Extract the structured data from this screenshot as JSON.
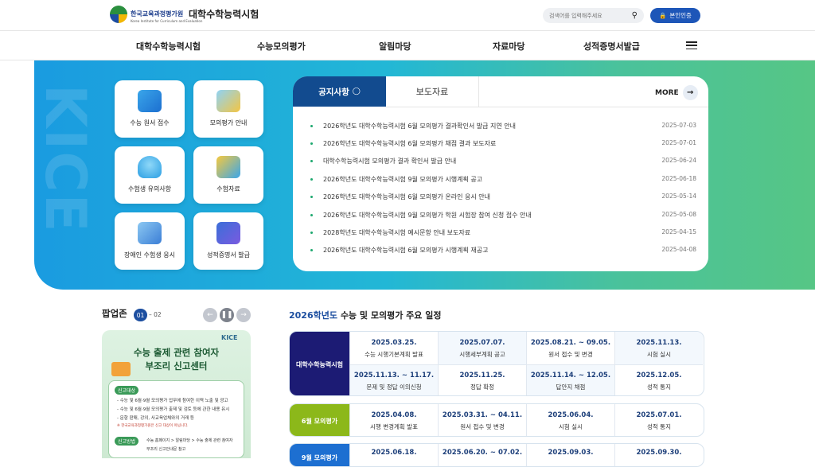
{
  "header": {
    "org_name": "한국교육과정평가원",
    "org_name_en": "Korea Institute for Curriculum and Evaluation",
    "site_title": "대학수학능력시험",
    "search_placeholder": "검색어를 입력해주세요",
    "auth_label": "본인인증"
  },
  "nav": {
    "items": [
      "대학수학능력시험",
      "수능모의평가",
      "알림마당",
      "자료마당",
      "성적증명서발급"
    ]
  },
  "hero": {
    "bg_text": "KICE",
    "tiles": [
      {
        "label": "수능 원서 접수",
        "icon": "laptop-icon"
      },
      {
        "label": "모의평가 안내",
        "icon": "book-icon"
      },
      {
        "label": "수험생 유의사항",
        "icon": "bell-icon"
      },
      {
        "label": "수험자료",
        "icon": "folder-search-icon"
      },
      {
        "label": "장애인 수험생 응시",
        "icon": "people-icon"
      },
      {
        "label": "성적증명서 발급",
        "icon": "monitor-document-icon"
      }
    ]
  },
  "notice": {
    "tab_active": "공지사항",
    "tab_other": "보도자료",
    "more_label": "MORE",
    "items": [
      {
        "title": "2026학년도 대학수학능력시험 6월 모의평가 결과확인서 발급 지연 안내",
        "date": "2025-07-03"
      },
      {
        "title": "2026학년도 대학수학능력시험 6월 모의평가 채점 결과 보도자료",
        "date": "2025-07-01"
      },
      {
        "title": "대학수학능력시험 모의평가 결과 확인서 발급 안내",
        "date": "2025-06-24"
      },
      {
        "title": "2026학년도 대학수학능력시험 9월 모의평가 시행계획 공고",
        "date": "2025-06-18"
      },
      {
        "title": "2026학년도 대학수학능력시험 6월 모의평가 온라인 응시 안내",
        "date": "2025-05-14"
      },
      {
        "title": "2026학년도 대학수학능력시험 9월 모의평가 학원 시험장 참여 신청 접수 안내",
        "date": "2025-05-08"
      },
      {
        "title": "2028학년도 대학수학능력시험 예시문항 안내 보도자료",
        "date": "2025-04-15"
      },
      {
        "title": "2026학년도 대학수학능력시험 6월 모의평가 시행계획 재공고",
        "date": "2025-04-08"
      }
    ]
  },
  "popup": {
    "title": "팝업존",
    "current": "01",
    "separator": "– 02",
    "logo_text": "KICE",
    "headline_1": "수능 출제 관련 참여자",
    "headline_2": "부조리 신고센터",
    "tag_1": "신고대상",
    "lines": [
      "- 수능 및 6월·9월 모의평가 업무에 참여한 이력 노출 및 광고",
      "- 수능 및 6월·9월 모의평가 출제 및 검토 등에 관한 내용 유시",
      "- 문항 판매, 강의, 사교육업체와의 거래 등",
      "※ 한국교육과정평가원은 신고 대상이 아닙니다."
    ],
    "tag_2": "신고방법",
    "method_1": "수능 홈페이지 > 알림마당 > 수능 출제 관련 참여자",
    "method_2": "부조리 신고안내문 참고"
  },
  "schedule": {
    "year": "2026학년도",
    "title_rest": " 수능 및 모의평가 주요 일정",
    "rows": [
      {
        "label": "대학수학능력시험",
        "color": "#1c1b74",
        "cells": [
          {
            "date": "2025.03.25.",
            "event": "수능 시행기본계획 발표"
          },
          {
            "date": "2025.07.07.",
            "event": "시행세부계획 공고"
          },
          {
            "date": "2025.08.21. ~ 09.05.",
            "event": "원서 접수 및 변경"
          },
          {
            "date": "2025.11.13.",
            "event": "시험 실시"
          },
          {
            "date": "2025.11.13. ~ 11.17.",
            "event": "문제 및 정답 이의신청"
          },
          {
            "date": "2025.11.25.",
            "event": "정답 확정"
          },
          {
            "date": "2025.11.14. ~ 12.05.",
            "event": "답안지 채점"
          },
          {
            "date": "2025.12.05.",
            "event": "성적 통지"
          }
        ]
      },
      {
        "label": "6월 모의평가",
        "color": "#8cb81a",
        "cells": [
          {
            "date": "2025.04.08.",
            "event": "시행 변경계획 발표"
          },
          {
            "date": "2025.03.31. ~ 04.11.",
            "event": "원서 접수 및 변경"
          },
          {
            "date": "2025.06.04.",
            "event": "시험 실시"
          },
          {
            "date": "2025.07.01.",
            "event": "성적 통지"
          }
        ]
      },
      {
        "label": "9월 모의평가",
        "color": "#1d6fd1",
        "cells": [
          {
            "date": "2025.06.18.",
            "event": ""
          },
          {
            "date": "2025.06.20. ~ 07.02.",
            "event": ""
          },
          {
            "date": "2025.09.03.",
            "event": ""
          },
          {
            "date": "2025.09.30.",
            "event": ""
          }
        ]
      }
    ]
  }
}
